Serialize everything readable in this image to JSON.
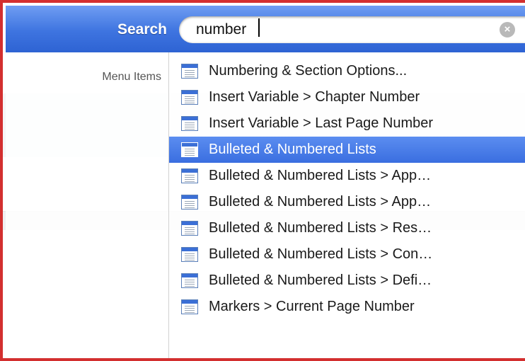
{
  "search": {
    "label": "Search",
    "query": "number",
    "clear_icon": "clear-circle-icon"
  },
  "results": {
    "category_label": "Menu Items",
    "selected_index": 3,
    "items": [
      {
        "label": "Numbering & Section Options...",
        "icon": "menu-item-icon"
      },
      {
        "label": "Insert Variable > Chapter Number",
        "icon": "menu-item-icon"
      },
      {
        "label": "Insert Variable > Last Page Number",
        "icon": "menu-item-icon"
      },
      {
        "label": "Bulleted & Numbered Lists",
        "icon": "menu-item-icon"
      },
      {
        "label": "Bulleted & Numbered Lists > App…",
        "icon": "menu-item-icon"
      },
      {
        "label": "Bulleted & Numbered Lists > App…",
        "icon": "menu-item-icon"
      },
      {
        "label": "Bulleted & Numbered Lists > Res…",
        "icon": "menu-item-icon"
      },
      {
        "label": "Bulleted & Numbered Lists > Con…",
        "icon": "menu-item-icon"
      },
      {
        "label": "Bulleted & Numbered Lists > Defi…",
        "icon": "menu-item-icon"
      },
      {
        "label": "Markers > Current Page Number",
        "icon": "menu-item-icon"
      }
    ]
  },
  "colors": {
    "search_bar": "#3e74e0",
    "selection": "#3a6ee0",
    "frame": "#d32f2f"
  }
}
